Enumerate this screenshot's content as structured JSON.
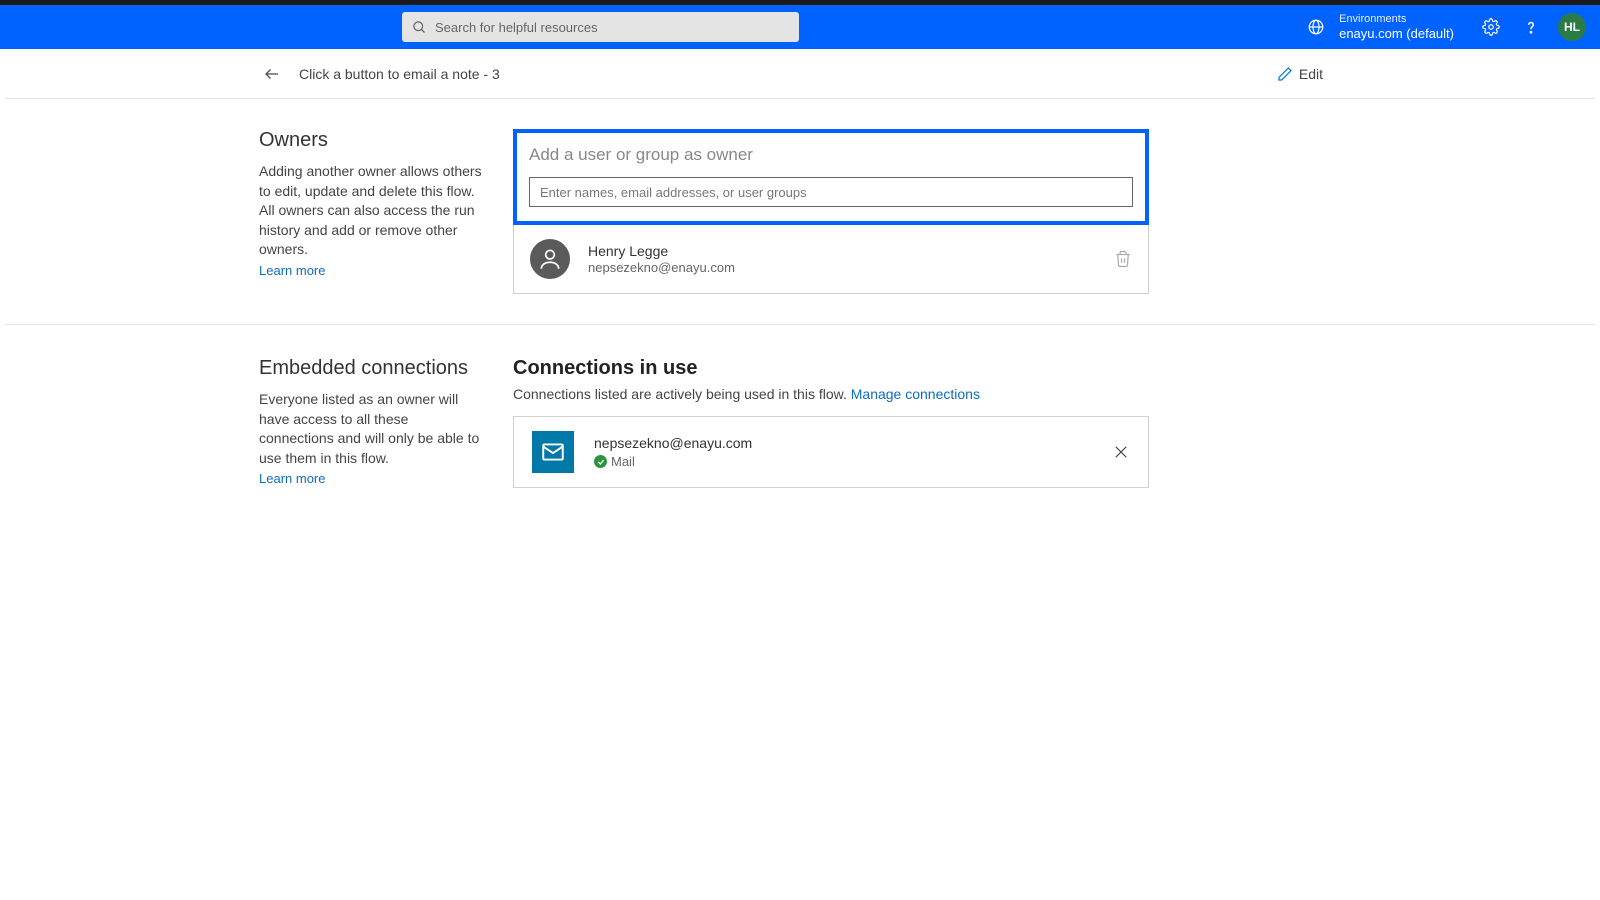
{
  "header": {
    "search_placeholder": "Search for helpful resources",
    "env_label": "Environments",
    "env_name": "enayu.com (default)",
    "avatar_initials": "HL"
  },
  "subheader": {
    "title": "Click a button to email a note - 3",
    "edit_label": "Edit"
  },
  "owners": {
    "heading": "Owners",
    "description": "Adding another owner allows others to edit, update and delete this flow. All owners can also access the run history and add or remove other owners.",
    "learn_more": "Learn more",
    "add_title": "Add a user or group as owner",
    "add_placeholder": "Enter names, email addresses, or user groups",
    "list": [
      {
        "name": "Henry Legge",
        "email": "nepsezekno@enayu.com"
      }
    ]
  },
  "connections": {
    "left_heading": "Embedded connections",
    "left_description": "Everyone listed as an owner will have access to all these connections and will only be able to use them in this flow.",
    "learn_more": "Learn more",
    "right_heading": "Connections in use",
    "right_sub": "Connections listed are actively being used in this flow.",
    "manage_link": "Manage connections",
    "list": [
      {
        "email": "nepsezekno@enayu.com",
        "type": "Mail"
      }
    ]
  }
}
